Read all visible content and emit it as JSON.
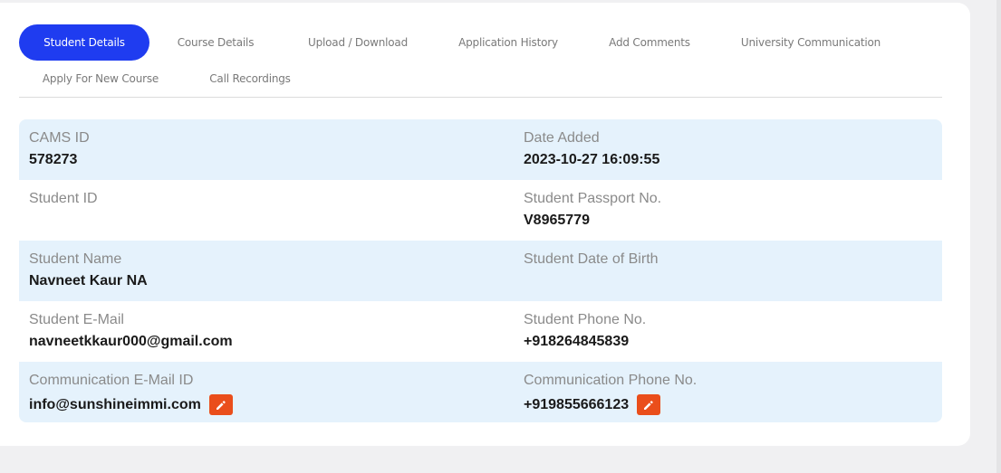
{
  "tabs": [
    {
      "label": "Student Details",
      "active": true
    },
    {
      "label": "Course Details",
      "active": false
    },
    {
      "label": "Upload / Download",
      "active": false
    },
    {
      "label": "Application History",
      "active": false
    },
    {
      "label": "Add Comments",
      "active": false
    },
    {
      "label": "University Communication",
      "active": false
    },
    {
      "label": "Apply For New Course",
      "active": false
    },
    {
      "label": "Call Recordings",
      "active": false
    }
  ],
  "details": {
    "rows": [
      {
        "left": {
          "label": "CAMS ID",
          "value": "578273"
        },
        "right": {
          "label": "Date Added",
          "value": "2023-10-27 16:09:55"
        }
      },
      {
        "left": {
          "label": "Student ID",
          "value": ""
        },
        "right": {
          "label": "Student Passport No.",
          "value": "V8965779"
        }
      },
      {
        "left": {
          "label": "Student Name",
          "value": "Navneet Kaur NA"
        },
        "right": {
          "label": "Student Date of Birth",
          "value": ""
        }
      },
      {
        "left": {
          "label": "Student E-Mail",
          "value": "navneetkkaur000@gmail.com"
        },
        "right": {
          "label": "Student Phone No.",
          "value": "+918264845839"
        }
      },
      {
        "left": {
          "label": "Communication E-Mail ID",
          "value": "info@sunshineimmi.com"
        },
        "right": {
          "label": "Communication Phone No.",
          "value": "+919855666123"
        }
      }
    ]
  },
  "icons": {
    "edit": "pencil-icon"
  },
  "colors": {
    "accent": "#1f3cf0",
    "edit_button": "#ea4e1b",
    "row_highlight": "#e5f2fc"
  }
}
